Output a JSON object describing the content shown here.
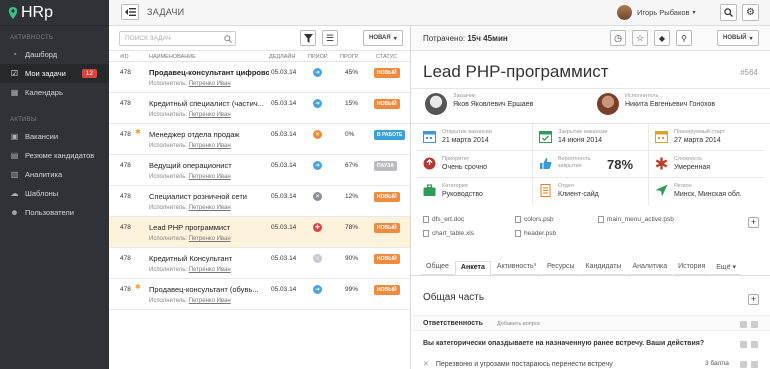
{
  "app": {
    "logo": "HRp"
  },
  "sidebar": {
    "sections": [
      {
        "title": "АКТИВНОСТЬ",
        "items": [
          {
            "label": "Дашборд",
            "icon": "dashboard-icon",
            "active": false
          },
          {
            "label": "Мои задачи",
            "icon": "checkbox-icon",
            "active": true,
            "badge": "12"
          },
          {
            "label": "Календарь",
            "icon": "calendar-icon",
            "active": false
          }
        ]
      },
      {
        "title": "АКТИВЫ",
        "items": [
          {
            "label": "Вакансии",
            "icon": "briefcase-icon"
          },
          {
            "label": "Резюме кандидатов",
            "icon": "resume-icon"
          },
          {
            "label": "Аналитика",
            "icon": "chart-icon"
          },
          {
            "label": "Шаблоны",
            "icon": "templates-icon"
          },
          {
            "label": "Пользователи",
            "icon": "users-icon"
          }
        ]
      }
    ]
  },
  "header": {
    "title": "ЗАДАЧИ",
    "user_name": "Игорь Рыбаков"
  },
  "list": {
    "search_placeholder": "ПОИСК ЗАДАЧ",
    "sort_label": "НОВАЯ",
    "columns": {
      "id": "#ID",
      "name": "НАИМЕНОВАНИЕ",
      "deadline": "ДЕДЛАЙН",
      "priority": "ПРИОР.",
      "progress": "ПРОГР.",
      "status": "СТАТУС"
    },
    "executor_prefix": "Исполнитель:",
    "rows": [
      {
        "id": "478",
        "star": false,
        "name": "Продавец-консультант цифрово...",
        "bold": true,
        "executor": "Петренко Иван",
        "date": "05.03.14",
        "priority_color": "#4aa3df",
        "priority_glyph": "➜",
        "progress": "45%",
        "status": "НОВЫЙ",
        "status_color": "#f08a3c",
        "selected": false
      },
      {
        "id": "478",
        "star": false,
        "name": "Кредитный специалист (частич...",
        "bold": false,
        "executor": "Петренко Иван",
        "date": "05.03.14",
        "priority_color": "#4aa3df",
        "priority_glyph": "➜",
        "progress": "15%",
        "status": "НОВЫЙ",
        "status_color": "#f08a3c",
        "selected": false
      },
      {
        "id": "478",
        "star": true,
        "name": "Менеджер отдела продаж",
        "bold": false,
        "executor": "Петренко Иван",
        "date": "05.03.14",
        "priority_color": "#f08a3c",
        "priority_glyph": "✕",
        "progress": "0%",
        "status": "В РАБОТЕ",
        "status_color": "#39a0db",
        "selected": false
      },
      {
        "id": "478",
        "star": false,
        "name": "Ведущий операционист",
        "bold": false,
        "executor": "Петренко Иван",
        "date": "05.03.14",
        "priority_color": "#4aa3df",
        "priority_glyph": "➜",
        "progress": "67%",
        "status": "ПАУЗА",
        "status_color": "#b8bcc1",
        "selected": false
      },
      {
        "id": "478",
        "star": false,
        "name": "Специалист розничной сети",
        "bold": false,
        "executor": "Петренко Иван",
        "date": "05.03.14",
        "priority_color": "#8a8f96",
        "priority_glyph": "✕",
        "progress": "12%",
        "status": "НОВЫЙ",
        "status_color": "#f08a3c",
        "selected": false
      },
      {
        "id": "478",
        "star": false,
        "name": "Lead PHP программист",
        "bold": false,
        "executor": "Петренко Иван",
        "date": "05.03.14",
        "priority_color": "#d9453d",
        "priority_glyph": "✚",
        "progress": "78%",
        "status": "НОВЫЙ",
        "status_color": "#f08a3c",
        "selected": true
      },
      {
        "id": "478",
        "star": false,
        "name": "Кредитный Консультант",
        "bold": false,
        "executor": "Петренко Иван",
        "date": "05.03.14",
        "priority_color": "#c8ccd0",
        "priority_glyph": "○",
        "progress": "90%",
        "status": "НОВЫЙ",
        "status_color": "#f08a3c",
        "selected": false
      },
      {
        "id": "478",
        "star": true,
        "name": "Продавец-консультант (обувь...",
        "bold": false,
        "executor": "Петренко Иван",
        "date": "05.03.14",
        "priority_color": "#4aa3df",
        "priority_glyph": "➜",
        "progress": "99%",
        "status": "НОВЫЙ",
        "status_color": "#f08a3c",
        "selected": false
      }
    ]
  },
  "detail": {
    "spent_label": "Потрачено:",
    "spent_value": "15ч 45мин",
    "sort_label": "НОВЫЙ",
    "title": "Lead PHP-программист",
    "id": "#564",
    "customer": {
      "label": "Заказчик",
      "name": "Яков Яковлевич Ершаев"
    },
    "executor": {
      "label": "Исполнитель",
      "name": "Никита Евгеньевич Гонохов"
    },
    "fields": [
      {
        "label": "Открытие вакансии",
        "value": "21 марта 2014",
        "icon": "calendar-icon"
      },
      {
        "label": "Закрытие вакансии",
        "value": "14 июня 2014",
        "icon": "calendar-check-icon"
      },
      {
        "label": "Планируемый старт",
        "value": "27 марта 2014",
        "icon": "calendar-icon"
      },
      {
        "label": "Приоритет",
        "value": "Очень срочно",
        "icon": "priority-icon"
      },
      {
        "label": "Вероятность закрытия",
        "value": "",
        "big": "78%",
        "icon": "thumbs-up-icon"
      },
      {
        "label": "Сложность",
        "value": "Умеренная",
        "icon": "asterisk-icon"
      },
      {
        "label": "Категория",
        "value": "Руководство",
        "icon": "briefcase-icon"
      },
      {
        "label": "Отдел",
        "value": "Клиент-сайд",
        "icon": "document-icon"
      },
      {
        "label": "Регион",
        "value": "Минск, Минская обл.",
        "icon": "location-arrow-icon"
      }
    ],
    "files": [
      "dfs_ert.doc",
      "colors.psb",
      "main_menu_active.psb",
      "chart_table.xls",
      "header.psb"
    ],
    "tabs": [
      {
        "label": "Общее",
        "active": false
      },
      {
        "label": "Анкета",
        "active": true
      },
      {
        "label": "Активность³",
        "active": false
      },
      {
        "label": "Ресурсы",
        "active": false
      },
      {
        "label": "Кандидаты",
        "active": false
      },
      {
        "label": "Аналитика",
        "active": false
      },
      {
        "label": "История",
        "active": false
      },
      {
        "label": "Ещё ▾",
        "active": false
      }
    ],
    "section_title": "Общая часть",
    "resp_title": "Ответственность",
    "add_question": "Добавить вопрос",
    "question": "Вы категорически опаздываете на назначенную ранее встречу. Ваши действия?",
    "answer": "Перезвоню и угрозами постараюсь перенести встречу",
    "answer_score": "3 балла"
  },
  "colors": {
    "sidebar": "#2f3236",
    "badge": "#d9453d",
    "selected_row": "#fdf2dc",
    "status_new": "#f08a3c",
    "status_work": "#39a0db"
  }
}
